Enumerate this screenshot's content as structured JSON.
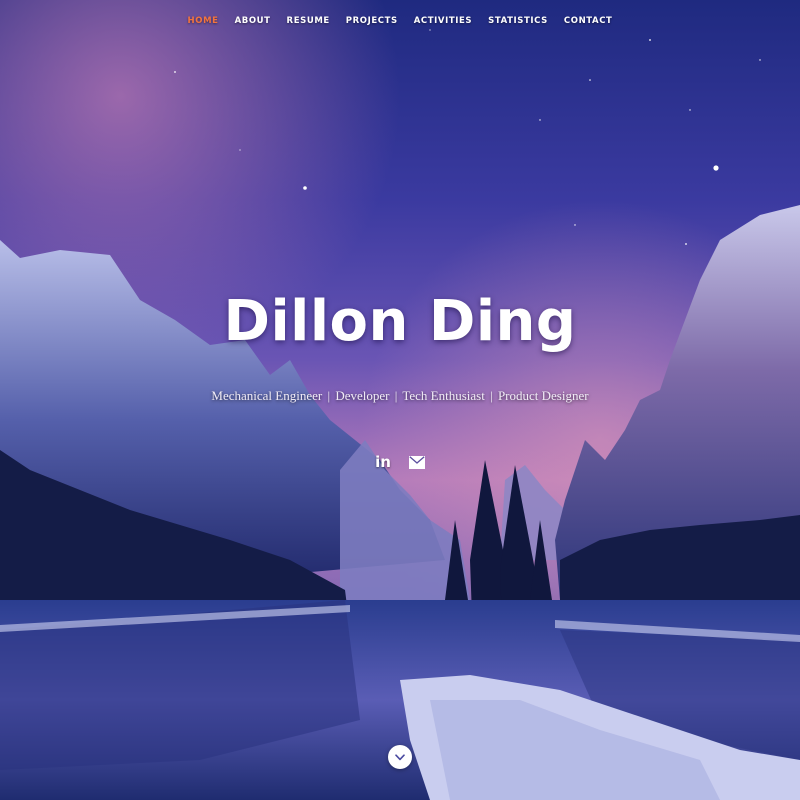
{
  "nav": {
    "items": [
      {
        "label": "HOME",
        "active": true
      },
      {
        "label": "ABOUT",
        "active": false
      },
      {
        "label": "RESUME",
        "active": false
      },
      {
        "label": "PROJECTS",
        "active": false
      },
      {
        "label": "ACTIVITIES",
        "active": false
      },
      {
        "label": "STATISTICS",
        "active": false
      },
      {
        "label": "CONTACT",
        "active": false
      }
    ],
    "active_color": "#f3743e"
  },
  "hero": {
    "name": "Dillon Ding",
    "roles": [
      "Mechanical Engineer",
      "Developer",
      "Tech Enthusiast",
      "Product Designer"
    ],
    "separator": "|"
  },
  "social": [
    {
      "icon": "linkedin-icon",
      "glyph": "in"
    },
    {
      "icon": "envelope-icon",
      "glyph": ""
    }
  ],
  "scroll": {
    "icon": "chevron-down-icon"
  }
}
